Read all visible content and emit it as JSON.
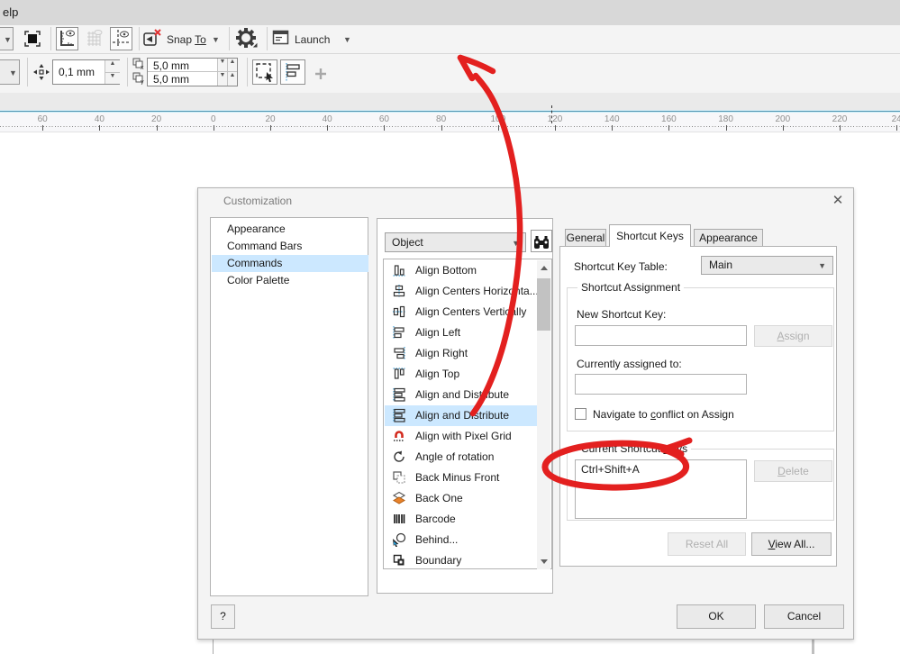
{
  "menu": {
    "help_partial": "elp"
  },
  "toolbar": {
    "snap_to_label": "Snap To",
    "snap_to_mnemonic": "To",
    "launch_label": "Launch",
    "nudge_value": "0,1 mm",
    "duplicate_x_value": "5,0 mm",
    "duplicate_y_value": "5,0 mm"
  },
  "ruler": {
    "labels": [
      "60",
      "40",
      "20",
      "0",
      "20",
      "40",
      "60",
      "80",
      "100",
      "120",
      "140",
      "160",
      "180",
      "200",
      "220",
      "24"
    ]
  },
  "dialog": {
    "title": "Customization",
    "tree": {
      "items": [
        "Appearance",
        "Command Bars",
        "Commands",
        "Color Palette"
      ],
      "selected_index": 2
    },
    "search": {
      "category_value": "Object"
    },
    "commands": {
      "selected_index": 7,
      "items": [
        {
          "label": "Align Bottom",
          "icon": "align-bottom-icon"
        },
        {
          "label": "Align Centers Horizonta...",
          "icon": "align-centers-horizontally-icon"
        },
        {
          "label": "Align Centers Vertically",
          "icon": "align-centers-vertically-icon"
        },
        {
          "label": "Align Left",
          "icon": "align-left-icon"
        },
        {
          "label": "Align Right",
          "icon": "align-right-icon"
        },
        {
          "label": "Align Top",
          "icon": "align-top-icon"
        },
        {
          "label": "Align and Distribute",
          "icon": "align-distribute-icon"
        },
        {
          "label": "Align and Distribute",
          "icon": "align-distribute-icon"
        },
        {
          "label": "Align with Pixel Grid",
          "icon": "align-pixel-grid-icon"
        },
        {
          "label": "Angle of rotation",
          "icon": "angle-rotation-icon"
        },
        {
          "label": "Back Minus Front",
          "icon": "back-minus-front-icon"
        },
        {
          "label": "Back One",
          "icon": "back-one-icon"
        },
        {
          "label": "Barcode",
          "icon": "barcode-icon"
        },
        {
          "label": "Behind...",
          "icon": "behind-icon"
        },
        {
          "label": "Boundary",
          "icon": "boundary-icon"
        }
      ]
    },
    "tabs": {
      "items": [
        "General",
        "Shortcut Keys",
        "Appearance"
      ],
      "active_index": 1
    },
    "shortcut_panel": {
      "table_label": "Shortcut Key Table:",
      "table_value": "Main",
      "assignment_group_label": "Shortcut Assignment",
      "new_key_label": "New Shortcut Key:",
      "new_key_value": "",
      "assign_label": "Assign",
      "assign_mnemonic": "A",
      "assigned_to_label": "Currently assigned to:",
      "assigned_to_value": "",
      "navigate_label": "Navigate to conflict on Assign",
      "navigate_mnemonic": "c",
      "navigate_checked": false,
      "current_group_label": "Current Shortcut Keys",
      "current_group_mnemonic": "K",
      "current_keys": [
        "Ctrl+Shift+A"
      ],
      "delete_label": "Delete",
      "delete_mnemonic": "D",
      "reset_all_label": "Reset All",
      "view_all_label": "View All...",
      "view_all_mnemonic": "V"
    },
    "footer": {
      "help_label": "?",
      "ok_label": "OK",
      "cancel_label": "Cancel"
    }
  },
  "annotations": {
    "color": "#e3201f"
  }
}
